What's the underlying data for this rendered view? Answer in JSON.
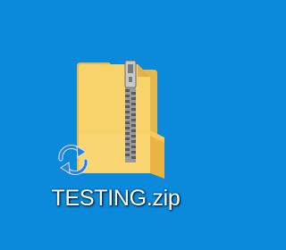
{
  "desktop": {
    "background_color": "#0b89da",
    "items": [
      {
        "label": "TESTING.zip",
        "icon": "zip-folder-icon",
        "overlay_icon": "sync-arrows-icon"
      }
    ]
  }
}
